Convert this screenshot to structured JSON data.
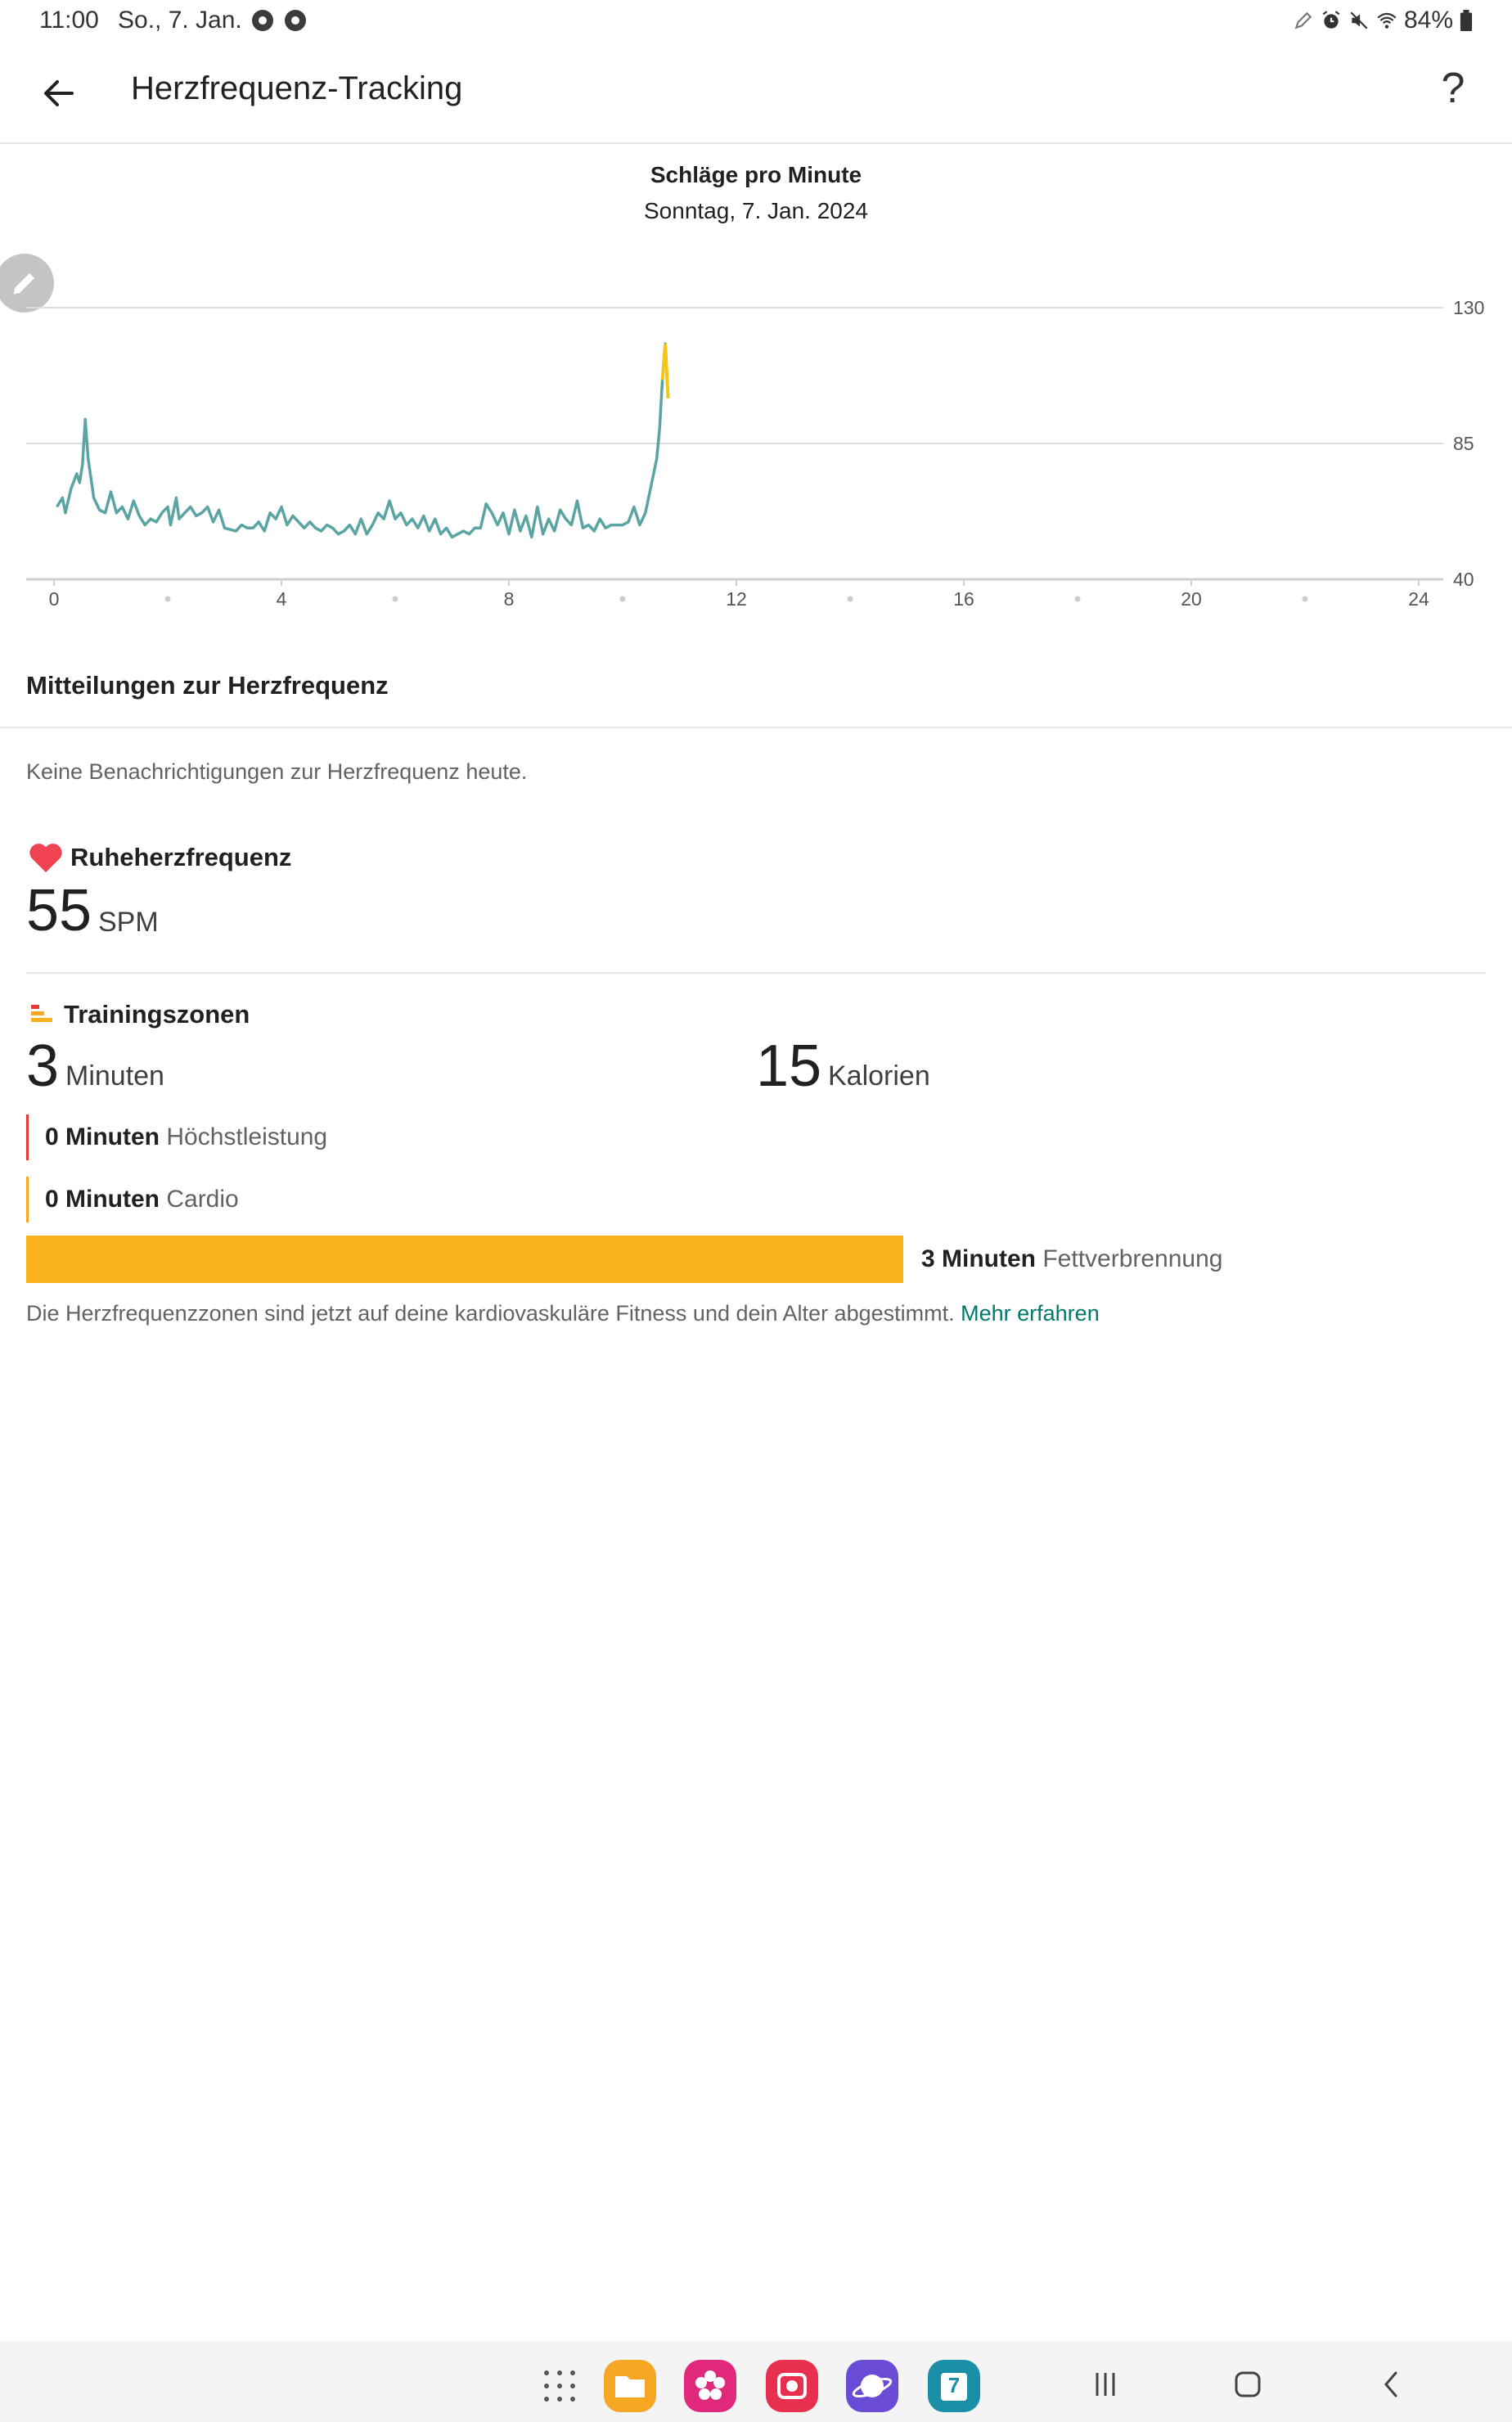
{
  "status_bar": {
    "time": "11:00",
    "date": "So., 7. Jan.",
    "battery": "84%",
    "icons": [
      "chrome-icon",
      "chrome-icon",
      "pen-icon",
      "alarm-icon",
      "mute-icon",
      "wifi-icon",
      "battery-icon"
    ]
  },
  "app_bar": {
    "title": "Herzfrequenz-Tracking",
    "help_label": "?"
  },
  "chart": {
    "title": "Schläge pro Minute",
    "subtitle": "Sonntag, 7. Jan. 2024"
  },
  "chart_data": {
    "type": "line",
    "title": "Schläge pro Minute",
    "subtitle": "Sonntag, 7. Jan. 2024",
    "xlabel": "",
    "ylabel": "",
    "xlim": [
      0,
      24
    ],
    "ylim": [
      40,
      130
    ],
    "y_ticks": [
      40,
      85,
      130
    ],
    "x_ticks": [
      0,
      4,
      8,
      12,
      16,
      20,
      24
    ],
    "grid": true,
    "series": [
      {
        "color": "#5ba4a4",
        "highlight_color": "#f5c518",
        "points": [
          [
            0.05,
            64
          ],
          [
            0.15,
            67
          ],
          [
            0.2,
            62
          ],
          [
            0.3,
            70
          ],
          [
            0.4,
            75
          ],
          [
            0.45,
            72
          ],
          [
            0.5,
            78
          ],
          [
            0.55,
            93
          ],
          [
            0.6,
            80
          ],
          [
            0.7,
            67
          ],
          [
            0.8,
            63
          ],
          [
            0.9,
            62
          ],
          [
            1.0,
            69
          ],
          [
            1.1,
            62
          ],
          [
            1.2,
            64
          ],
          [
            1.3,
            60
          ],
          [
            1.4,
            66
          ],
          [
            1.5,
            61
          ],
          [
            1.6,
            58
          ],
          [
            1.7,
            60
          ],
          [
            1.8,
            59
          ],
          [
            1.9,
            62
          ],
          [
            2.0,
            64
          ],
          [
            2.05,
            58
          ],
          [
            2.15,
            67
          ],
          [
            2.2,
            60
          ],
          [
            2.3,
            62
          ],
          [
            2.4,
            64
          ],
          [
            2.5,
            61
          ],
          [
            2.6,
            62
          ],
          [
            2.7,
            64
          ],
          [
            2.8,
            59
          ],
          [
            2.9,
            63
          ],
          [
            3.0,
            57
          ],
          [
            3.2,
            56
          ],
          [
            3.3,
            58
          ],
          [
            3.4,
            57
          ],
          [
            3.5,
            57
          ],
          [
            3.6,
            59
          ],
          [
            3.7,
            56
          ],
          [
            3.8,
            62
          ],
          [
            3.9,
            60
          ],
          [
            4.0,
            64
          ],
          [
            4.1,
            58
          ],
          [
            4.2,
            61
          ],
          [
            4.3,
            59
          ],
          [
            4.4,
            57
          ],
          [
            4.5,
            59
          ],
          [
            4.6,
            57
          ],
          [
            4.7,
            56
          ],
          [
            4.8,
            58
          ],
          [
            4.9,
            57
          ],
          [
            5.0,
            55
          ],
          [
            5.1,
            56
          ],
          [
            5.2,
            58
          ],
          [
            5.3,
            55
          ],
          [
            5.4,
            60
          ],
          [
            5.5,
            55
          ],
          [
            5.6,
            58
          ],
          [
            5.7,
            62
          ],
          [
            5.8,
            60
          ],
          [
            5.9,
            66
          ],
          [
            6.0,
            60
          ],
          [
            6.1,
            62
          ],
          [
            6.2,
            58
          ],
          [
            6.3,
            60
          ],
          [
            6.4,
            57
          ],
          [
            6.5,
            61
          ],
          [
            6.6,
            56
          ],
          [
            6.7,
            60
          ],
          [
            6.8,
            55
          ],
          [
            6.9,
            57
          ],
          [
            7.0,
            54
          ],
          [
            7.1,
            55
          ],
          [
            7.2,
            56
          ],
          [
            7.3,
            55
          ],
          [
            7.4,
            57
          ],
          [
            7.5,
            57
          ],
          [
            7.6,
            65
          ],
          [
            7.7,
            62
          ],
          [
            7.8,
            58
          ],
          [
            7.9,
            62
          ],
          [
            8.0,
            55
          ],
          [
            8.1,
            63
          ],
          [
            8.2,
            56
          ],
          [
            8.3,
            61
          ],
          [
            8.4,
            54
          ],
          [
            8.5,
            64
          ],
          [
            8.6,
            55
          ],
          [
            8.7,
            60
          ],
          [
            8.8,
            56
          ],
          [
            8.9,
            63
          ],
          [
            9.0,
            60
          ],
          [
            9.1,
            58
          ],
          [
            9.2,
            66
          ],
          [
            9.3,
            57
          ],
          [
            9.4,
            58
          ],
          [
            9.5,
            56
          ],
          [
            9.6,
            60
          ],
          [
            9.7,
            57
          ],
          [
            9.8,
            58
          ],
          [
            9.9,
            58
          ],
          [
            10.0,
            58
          ],
          [
            10.1,
            59
          ],
          [
            10.2,
            64
          ],
          [
            10.3,
            58
          ],
          [
            10.4,
            62
          ],
          [
            10.5,
            71
          ],
          [
            10.6,
            80
          ],
          [
            10.65,
            90
          ],
          [
            10.7,
            106
          ],
          [
            10.75,
            118
          ],
          [
            10.8,
            100
          ]
        ]
      }
    ]
  },
  "notifications": {
    "heading": "Mitteilungen zur Herzfrequenz",
    "empty_text": "Keine Benachrichtigungen zur Herzfrequenz heute."
  },
  "resting_hr": {
    "label": "Ruheherzfrequenz",
    "value": "55",
    "unit": "SPM"
  },
  "training_zones": {
    "label": "Trainingszonen",
    "minutes_value": "3",
    "minutes_unit": "Minuten",
    "calories_value": "15",
    "calories_unit": "Kalorien",
    "zones": [
      {
        "amount": "0 Minuten",
        "name": "Höchstleistung",
        "color": "#e53935",
        "fraction": 0
      },
      {
        "amount": "0 Minuten",
        "name": "Cardio",
        "color": "#f9a825",
        "fraction": 0
      },
      {
        "amount": "3 Minuten",
        "name": "Fettverbrennung",
        "color": "#f9b21c",
        "fraction": 1
      }
    ],
    "note": "Die Herzfrequenzzonen sind jetzt auf deine kardiovaskuläre Fitness und dein Alter abgestimmt.",
    "learn_more": "Mehr erfahren"
  },
  "nav_bar": {
    "dock_apps": [
      "app-drawer-icon",
      "files-icon",
      "gallery-icon",
      "screen-recorder-icon",
      "internet-icon",
      "calendar-icon"
    ],
    "calendar_day": "7",
    "buttons": [
      "recents-icon",
      "home-icon",
      "back-icon"
    ]
  }
}
